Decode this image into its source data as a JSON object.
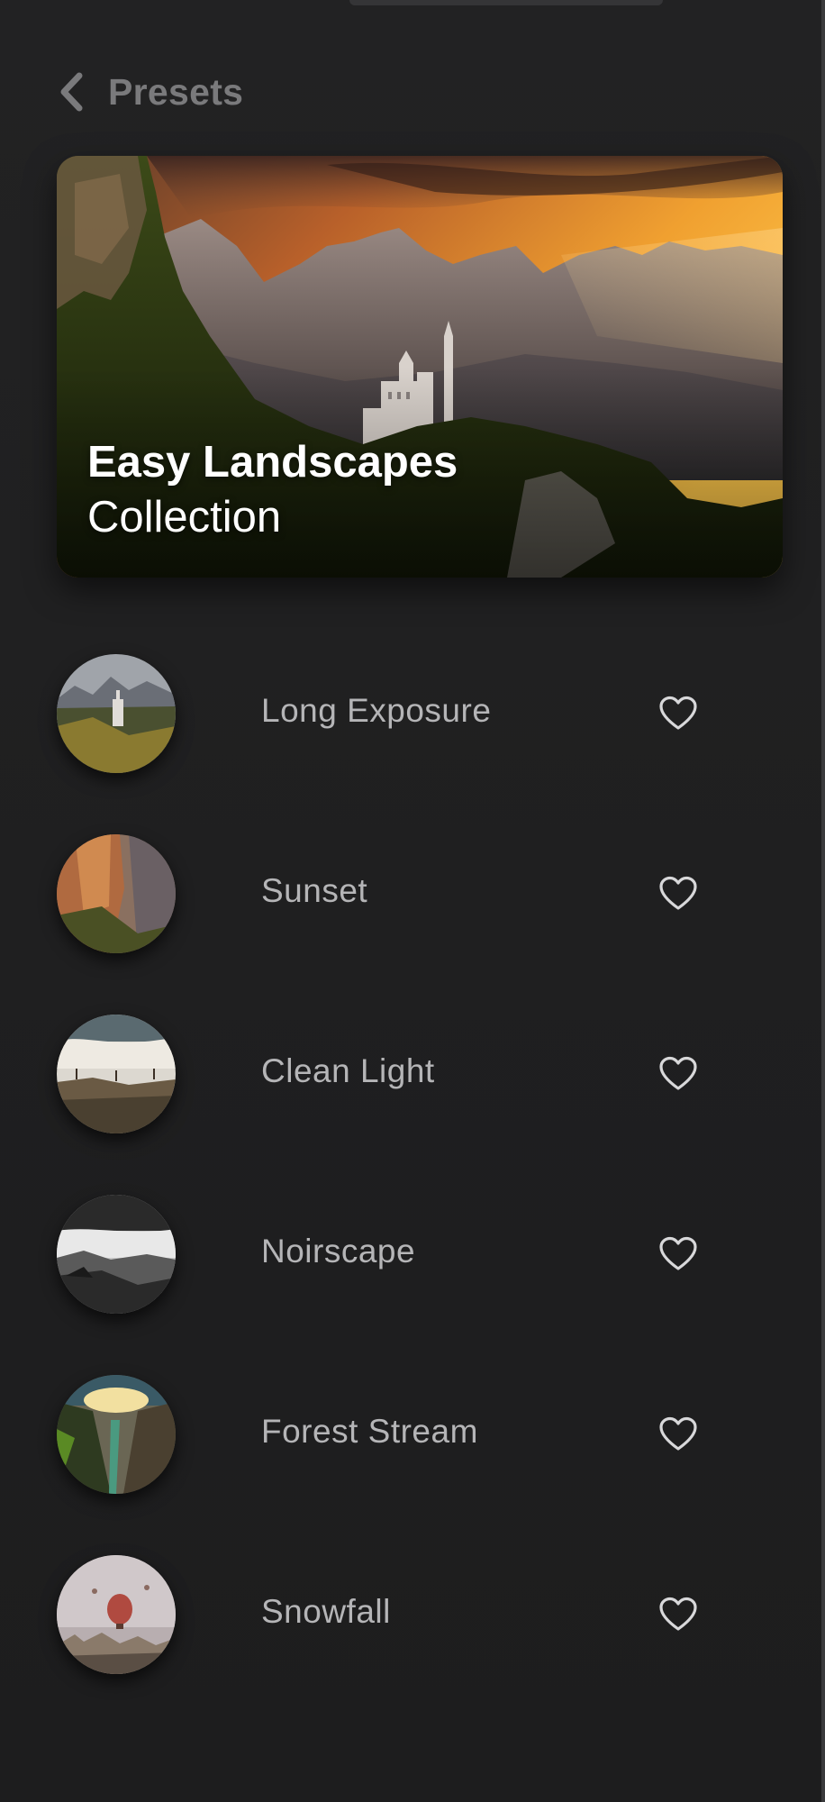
{
  "header": {
    "title": "Presets",
    "back_icon": "chevron-left-icon"
  },
  "hero": {
    "title": "Easy Landscapes",
    "subtitle": "Collection"
  },
  "presets": [
    {
      "label": "Long Exposure",
      "icon": "heart-icon",
      "favorited": false
    },
    {
      "label": "Sunset",
      "icon": "heart-icon",
      "favorited": false
    },
    {
      "label": "Clean Light",
      "icon": "heart-icon",
      "favorited": false
    },
    {
      "label": "Noirscape",
      "icon": "heart-icon",
      "favorited": false
    },
    {
      "label": "Forest Stream",
      "icon": "heart-icon",
      "favorited": false
    },
    {
      "label": "Snowfall",
      "icon": "heart-icon",
      "favorited": false
    }
  ],
  "colors": {
    "background": "#202021",
    "header_text": "#7a7a7c",
    "label_text": "#b5b5b7",
    "heart_stroke": "#d8d8da"
  }
}
